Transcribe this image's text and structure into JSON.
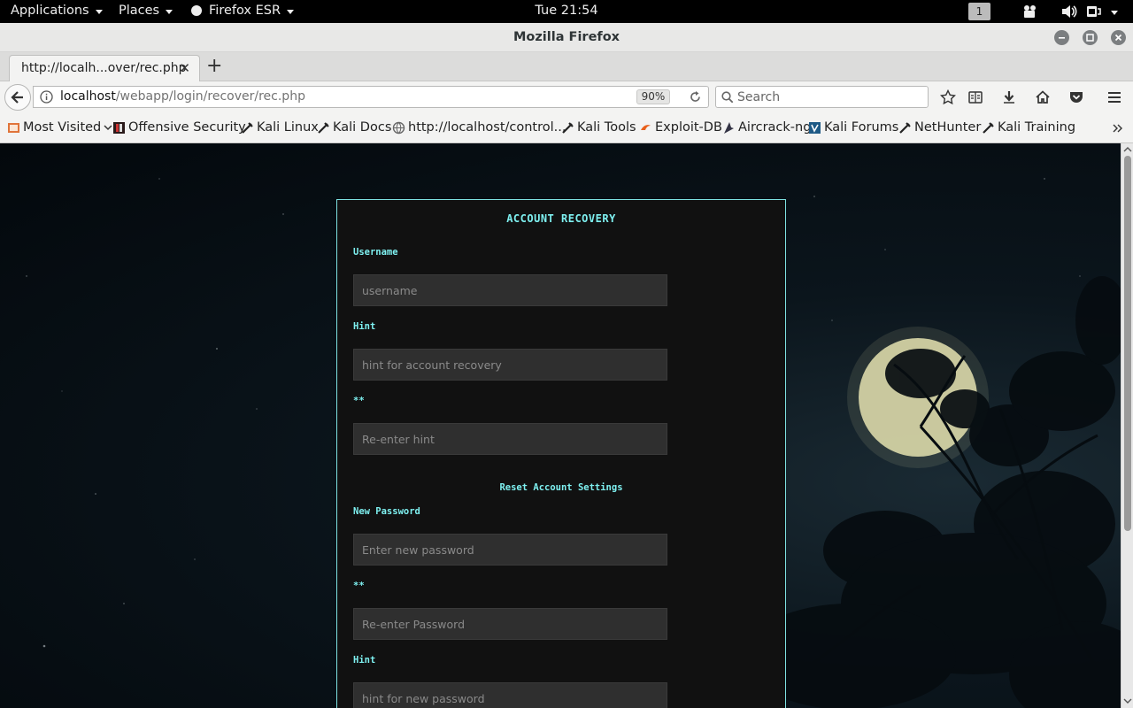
{
  "topbar": {
    "applications": "Applications",
    "places": "Places",
    "firefox": "Firefox ESR",
    "clock": "Tue 21:54",
    "workspace": "1"
  },
  "window": {
    "title": "Mozilla Firefox"
  },
  "tab": {
    "title": "http://localh...over/rec.php"
  },
  "nav": {
    "url_host": "localhost",
    "url_path": "/webapp/login/recover/rec.php",
    "zoom": "90%",
    "search_placeholder": "Search"
  },
  "bookmarks": [
    {
      "label": "Most Visited",
      "icon": "most-visited-icon"
    },
    {
      "label": "Offensive Security",
      "icon": "offsec-icon"
    },
    {
      "label": "Kali Linux",
      "icon": "kali-icon"
    },
    {
      "label": "Kali Docs",
      "icon": "kali-icon"
    },
    {
      "label": "http://localhost/control...",
      "icon": "globe-icon"
    },
    {
      "label": "Kali Tools",
      "icon": "kali-icon"
    },
    {
      "label": "Exploit-DB",
      "icon": "exploitdb-icon"
    },
    {
      "label": "Aircrack-ng",
      "icon": "aircrack-icon"
    },
    {
      "label": "Kali Forums",
      "icon": "kali-forums-icon"
    },
    {
      "label": "NetHunter",
      "icon": "kali-icon"
    },
    {
      "label": "Kali Training",
      "icon": "kali-icon"
    }
  ],
  "form": {
    "title": "ACCOUNT RECOVERY",
    "username_label": "Username",
    "username_placeholder": "username",
    "hint_label": "Hint",
    "hint_placeholder": "hint for account recovery",
    "hint_confirm_label": "**",
    "hint_confirm_placeholder": "Re-enter hint",
    "reset_heading": "Reset Account Settings",
    "new_password_label": "New Password",
    "new_password_placeholder": "Enter new password",
    "password_confirm_label": "**",
    "password_confirm_placeholder": "Re-enter Password",
    "new_hint_label": "Hint",
    "new_hint_placeholder": "hint for new password"
  }
}
